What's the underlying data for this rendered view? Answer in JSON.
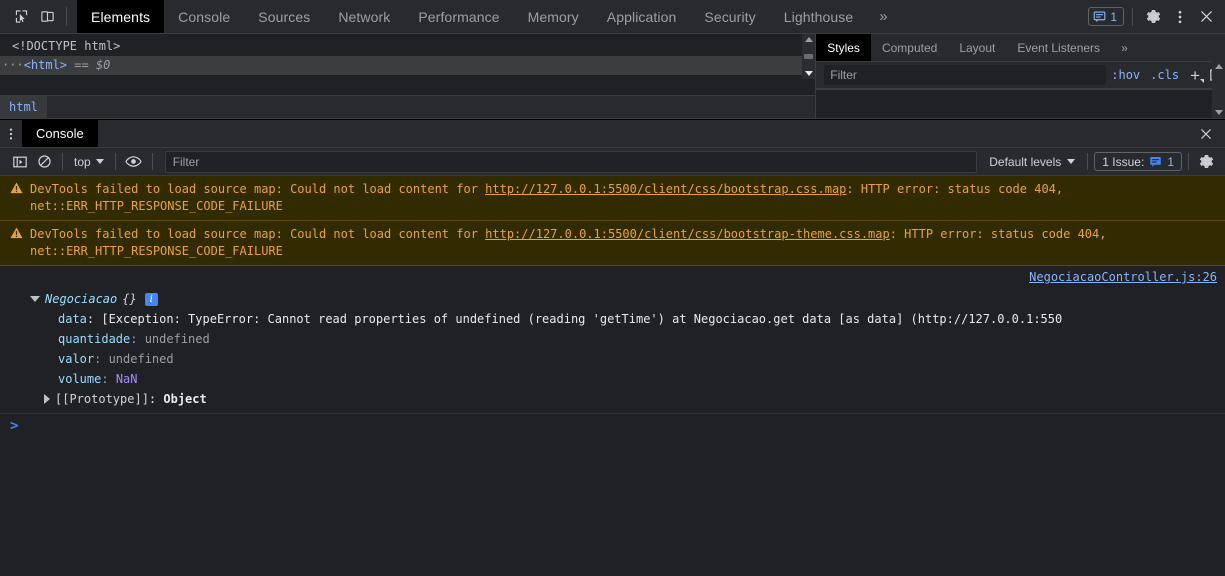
{
  "toolbar": {
    "inspect_icon": "inspect-cursor-icon",
    "device_icon": "device-toolbar-icon",
    "tabs": [
      {
        "label": "Elements",
        "active": true
      },
      {
        "label": "Console",
        "active": false
      },
      {
        "label": "Sources",
        "active": false
      },
      {
        "label": "Network",
        "active": false
      },
      {
        "label": "Performance",
        "active": false
      },
      {
        "label": "Memory",
        "active": false
      },
      {
        "label": "Application",
        "active": false
      },
      {
        "label": "Security",
        "active": false
      },
      {
        "label": "Lighthouse",
        "active": false
      }
    ],
    "more_tabs": "»",
    "message_count": "1",
    "settings_icon": "gear-icon",
    "more_icon": "kebab-menu-icon",
    "close_icon": "close-icon"
  },
  "elements": {
    "doctype": "<!DOCTYPE html>",
    "ellipsis": "···",
    "html_tag": "<html>",
    "selected_marker": "== $0",
    "breadcrumb": "html"
  },
  "styles": {
    "tabs": [
      {
        "label": "Styles",
        "active": true
      },
      {
        "label": "Computed",
        "active": false
      },
      {
        "label": "Layout",
        "active": false
      },
      {
        "label": "Event Listeners",
        "active": false
      }
    ],
    "more_tabs": "»",
    "filter_placeholder": "Filter",
    "filter_value": "",
    "hov_label": ":hov",
    "cls_label": ".cls",
    "new_rule_label": "+",
    "toggle_sidebar_icon": "toggle-right-panel-icon"
  },
  "drawer": {
    "menu_icon": "kebab-menu-icon",
    "tabs": [
      {
        "label": "Console",
        "active": true
      }
    ],
    "close_icon": "close-icon",
    "toolbar": {
      "sidebar_icon": "console-sidebar-icon",
      "clear_icon": "clear-console-icon",
      "context": "top",
      "eye_icon": "live-expression-eye-icon",
      "filter_placeholder": "Filter",
      "filter_value": "",
      "levels": "Default levels",
      "issues_label": "1 Issue:",
      "issues_count": "1",
      "settings_icon": "gear-icon"
    }
  },
  "console": {
    "warnings": [
      {
        "icon": "warning-triangle-icon",
        "prefix": "DevTools failed to load source map: Could not load content for ",
        "url": "http://127.0.0.1:5500/client/css/bootstrap.css.map",
        "suffix": ": HTTP error: status code 404, net::ERR_HTTP_RESPONSE_CODE_FAILURE"
      },
      {
        "icon": "warning-triangle-icon",
        "prefix": "DevTools failed to load source map: Could not load content for ",
        "url": "http://127.0.0.1:5500/client/css/bootstrap-theme.css.map",
        "suffix": ": HTTP error: status code 404, net::ERR_HTTP_RESPONSE_CODE_FAILURE"
      }
    ],
    "source_link": "NegociacaoController.js:26",
    "object": {
      "constructor": "Negociacao",
      "braces": "{}",
      "info_badge": "i",
      "properties": [
        {
          "name": "data",
          "value": "[Exception: TypeError: Cannot read properties of undefined (reading 'getTime') at Negociacao.get data [as data] (http://127.0.0.1:550",
          "kind": "exception"
        },
        {
          "name": "quantidade",
          "value": "undefined",
          "kind": "undefined"
        },
        {
          "name": "valor",
          "value": "undefined",
          "kind": "undefined"
        },
        {
          "name": "volume",
          "value": "NaN",
          "kind": "nan"
        }
      ],
      "prototype_name": "[[Prototype]]",
      "prototype_value": "Object"
    },
    "prompt": ">"
  },
  "colors": {
    "accent_blue": "#8ab4f8",
    "warning_bg": "#332b00",
    "warning_text": "#e8a33d",
    "badge_blue": "#4285f4",
    "nan_purple": "#a78bfa",
    "panel_bg": "#202124",
    "toolbar_bg": "#292a2d"
  }
}
